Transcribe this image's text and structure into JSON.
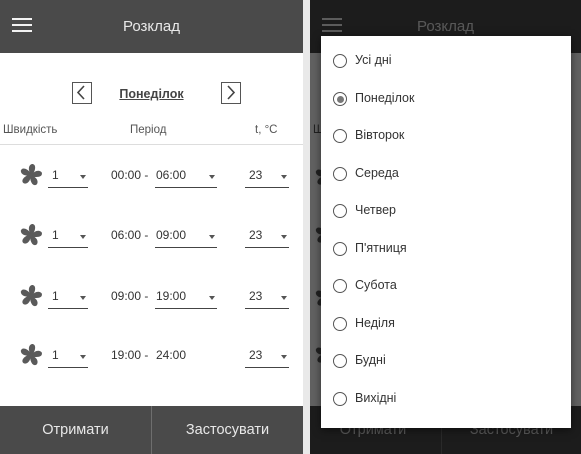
{
  "app_bar": {
    "title": "Розклад"
  },
  "day_nav": {
    "day": "Понеділок",
    "prev_label": "<",
    "next_label": ">"
  },
  "columns": {
    "speed": "Швидкість",
    "period": "Період",
    "temp": "t, °C"
  },
  "rows": [
    {
      "speed": "1",
      "start": "00:00",
      "sep": " - ",
      "end": "06:00",
      "temp": "23"
    },
    {
      "speed": "1",
      "start": "06:00",
      "sep": " - ",
      "end": "09:00",
      "temp": "23"
    },
    {
      "speed": "1",
      "start": "09:00",
      "sep": " - ",
      "end": "19:00",
      "temp": "23"
    },
    {
      "speed": "1",
      "start": "19:00",
      "sep": " - ",
      "end": "24:00",
      "temp": "23"
    }
  ],
  "bottom_bar": {
    "receive": "Отримати",
    "apply": "Застосувати"
  },
  "dialog": {
    "selected": "Понеділок",
    "options": [
      "Усі дні",
      "Понеділок",
      "Вівторок",
      "Середа",
      "Четвер",
      "П'ятниця",
      "Субота",
      "Неділя",
      "Будні",
      "Вихідні"
    ]
  },
  "colors": {
    "bar": "#4a4a4a",
    "bar_text": "#e8e8e8",
    "icon": "#5a5a5a"
  },
  "icons": {
    "menu": "hamburger-menu-icon",
    "fan": "fan-icon",
    "prev": "chevron-left-icon",
    "next": "chevron-right-icon",
    "dropdown": "caret-down-icon"
  }
}
